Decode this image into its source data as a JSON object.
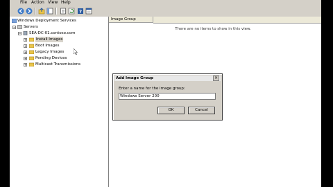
{
  "menubar": {
    "items": [
      "File",
      "Action",
      "View",
      "Help"
    ]
  },
  "toolbar": {
    "buttons": [
      "back-icon",
      "forward-icon",
      "up-icon",
      "show-hide-tree-icon",
      "properties-icon",
      "refresh-icon",
      "help-icon",
      "mmc-icon"
    ]
  },
  "tree": {
    "root": "Windows Deployment Services",
    "servers": "Servers",
    "server": "SEA-DC-01.contoso.com",
    "items": [
      "Install Images",
      "Boot Images",
      "Legacy Images",
      "Pending Devices",
      "Multicast Transmissions"
    ],
    "expand_symbol": "+",
    "collapse_symbol": "−"
  },
  "right_pane": {
    "column_header": "Image Group",
    "empty_message": "There are no items to show in this view."
  },
  "dialog": {
    "title": "Add Image Group",
    "close_symbol": "×",
    "prompt": "Enter a name for the image group:",
    "input_value": "Windows Server 200",
    "ok_label": "OK",
    "cancel_label": "Cancel"
  }
}
